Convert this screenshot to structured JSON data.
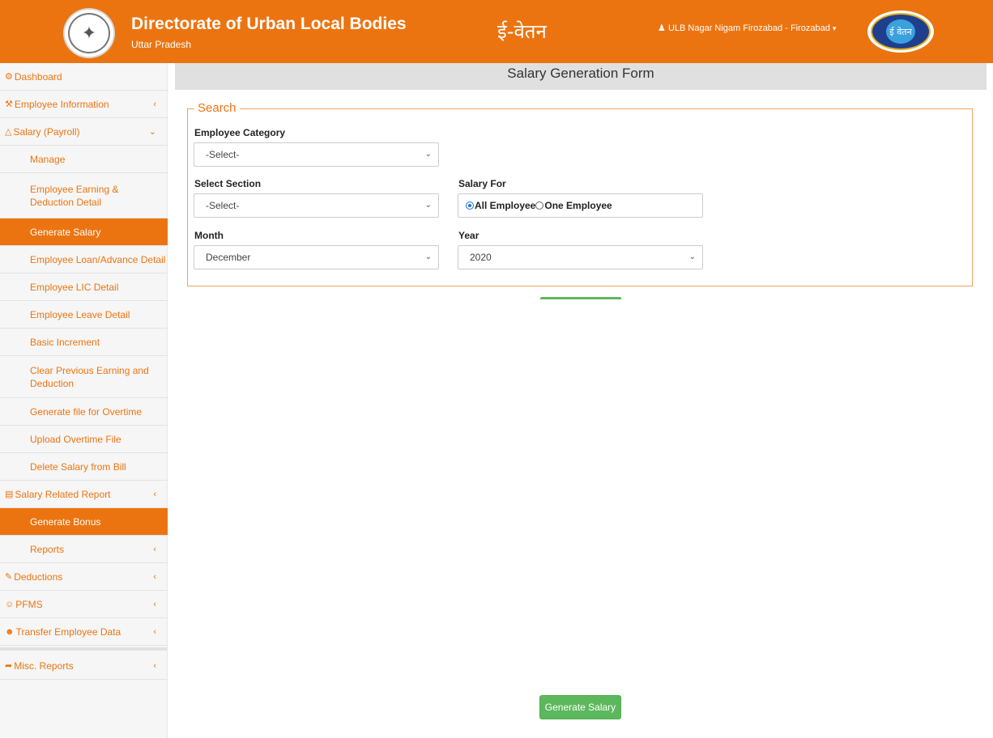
{
  "header": {
    "title": "Directorate of Urban Local Bodies",
    "subtitle": "Uttar Pradesh",
    "hindi_title": "ई-वेतन",
    "user_label": "ULB Nagar Nigam Firozabad - Firozabad",
    "right_logo_text": "ई वेतन"
  },
  "sidebar": {
    "items": [
      {
        "label": "Dashboard"
      },
      {
        "label": "Employee Information"
      },
      {
        "label": "Salary (Payroll)"
      },
      {
        "label": "Manage"
      },
      {
        "label": "Employee Earning & Deduction Detail"
      },
      {
        "label": "Generate Salary"
      },
      {
        "label": "Employee Loan/Advance Detail"
      },
      {
        "label": "Employee LIC Detail"
      },
      {
        "label": "Employee Leave Detail"
      },
      {
        "label": "Basic Increment"
      },
      {
        "label": "Clear Previous Earning and Deduction"
      },
      {
        "label": "Generate file for Overtime"
      },
      {
        "label": "Upload Overtime File"
      },
      {
        "label": "Delete Salary from Bill"
      },
      {
        "label": "Salary Related Report"
      },
      {
        "label": "Generate Bonus"
      },
      {
        "label": "Reports"
      },
      {
        "label": "Deductions"
      },
      {
        "label": "PFMS"
      },
      {
        "label": "Transfer Employee Data"
      },
      {
        "label": "Misc. Reports"
      }
    ]
  },
  "main": {
    "page_title": "Salary Generation Form",
    "legend": "Search",
    "employee_category": {
      "label": "Employee Category",
      "value": "-Select-"
    },
    "select_section": {
      "label": "Select Section",
      "value": "-Select-"
    },
    "salary_for": {
      "label": "Salary For",
      "option_all": "All Employee",
      "option_one": "One Employee"
    },
    "month": {
      "label": "Month",
      "value": "December"
    },
    "year": {
      "label": "Year",
      "value": "2020"
    },
    "generate_button": "Generate Salary"
  },
  "colors": {
    "accent": "#ec7410",
    "success": "#5cb85c"
  }
}
